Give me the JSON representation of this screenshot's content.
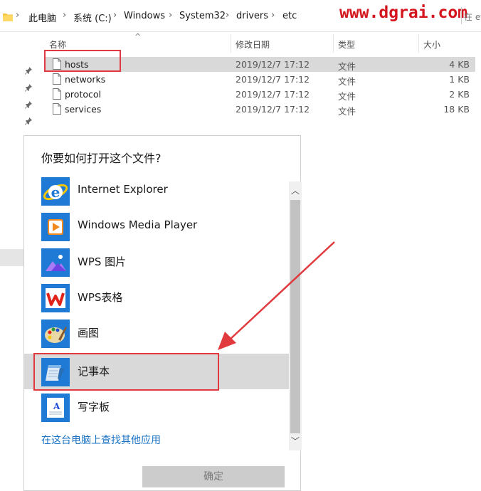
{
  "address_bar": {
    "crumbs": [
      "此电脑",
      "系统 (C:)",
      "Windows",
      "System32",
      "drivers",
      "etc"
    ],
    "watermark": "www.dgrai.com",
    "right_fragment": "在 etc"
  },
  "columns": {
    "name": "名称",
    "modified": "修改日期",
    "type": "类型",
    "size": "大小"
  },
  "files": [
    {
      "name": "hosts",
      "modified": "2019/12/7 17:12",
      "type": "文件",
      "size": "4 KB",
      "selected": true
    },
    {
      "name": "networks",
      "modified": "2019/12/7 17:12",
      "type": "文件",
      "size": "1 KB"
    },
    {
      "name": "protocol",
      "modified": "2019/12/7 17:12",
      "type": "文件",
      "size": "2 KB"
    },
    {
      "name": "services",
      "modified": "2019/12/7 17:12",
      "type": "文件",
      "size": "18 KB"
    }
  ],
  "dialog": {
    "title": "你要如何打开这个文件?",
    "apps": [
      {
        "label": "Internet Explorer",
        "icon": "internet-explorer-icon"
      },
      {
        "label": "Windows Media Player",
        "icon": "windows-media-player-icon"
      },
      {
        "label": "WPS 图片",
        "icon": "wps-picture-icon"
      },
      {
        "label": "WPS表格",
        "icon": "wps-spreadsheet-icon"
      },
      {
        "label": "画图",
        "icon": "paint-icon"
      },
      {
        "label": "记事本",
        "icon": "notepad-icon",
        "selected": true
      },
      {
        "label": "写字板",
        "icon": "wordpad-icon"
      }
    ],
    "more_apps_link": "在这台电脑上查找其他应用",
    "ok_button": "确定"
  },
  "colors": {
    "highlight_red": "#e03a3e",
    "link_blue": "#1a73c4",
    "selection_gray": "#d9d9d9",
    "watermark_red": "#d4151d"
  }
}
